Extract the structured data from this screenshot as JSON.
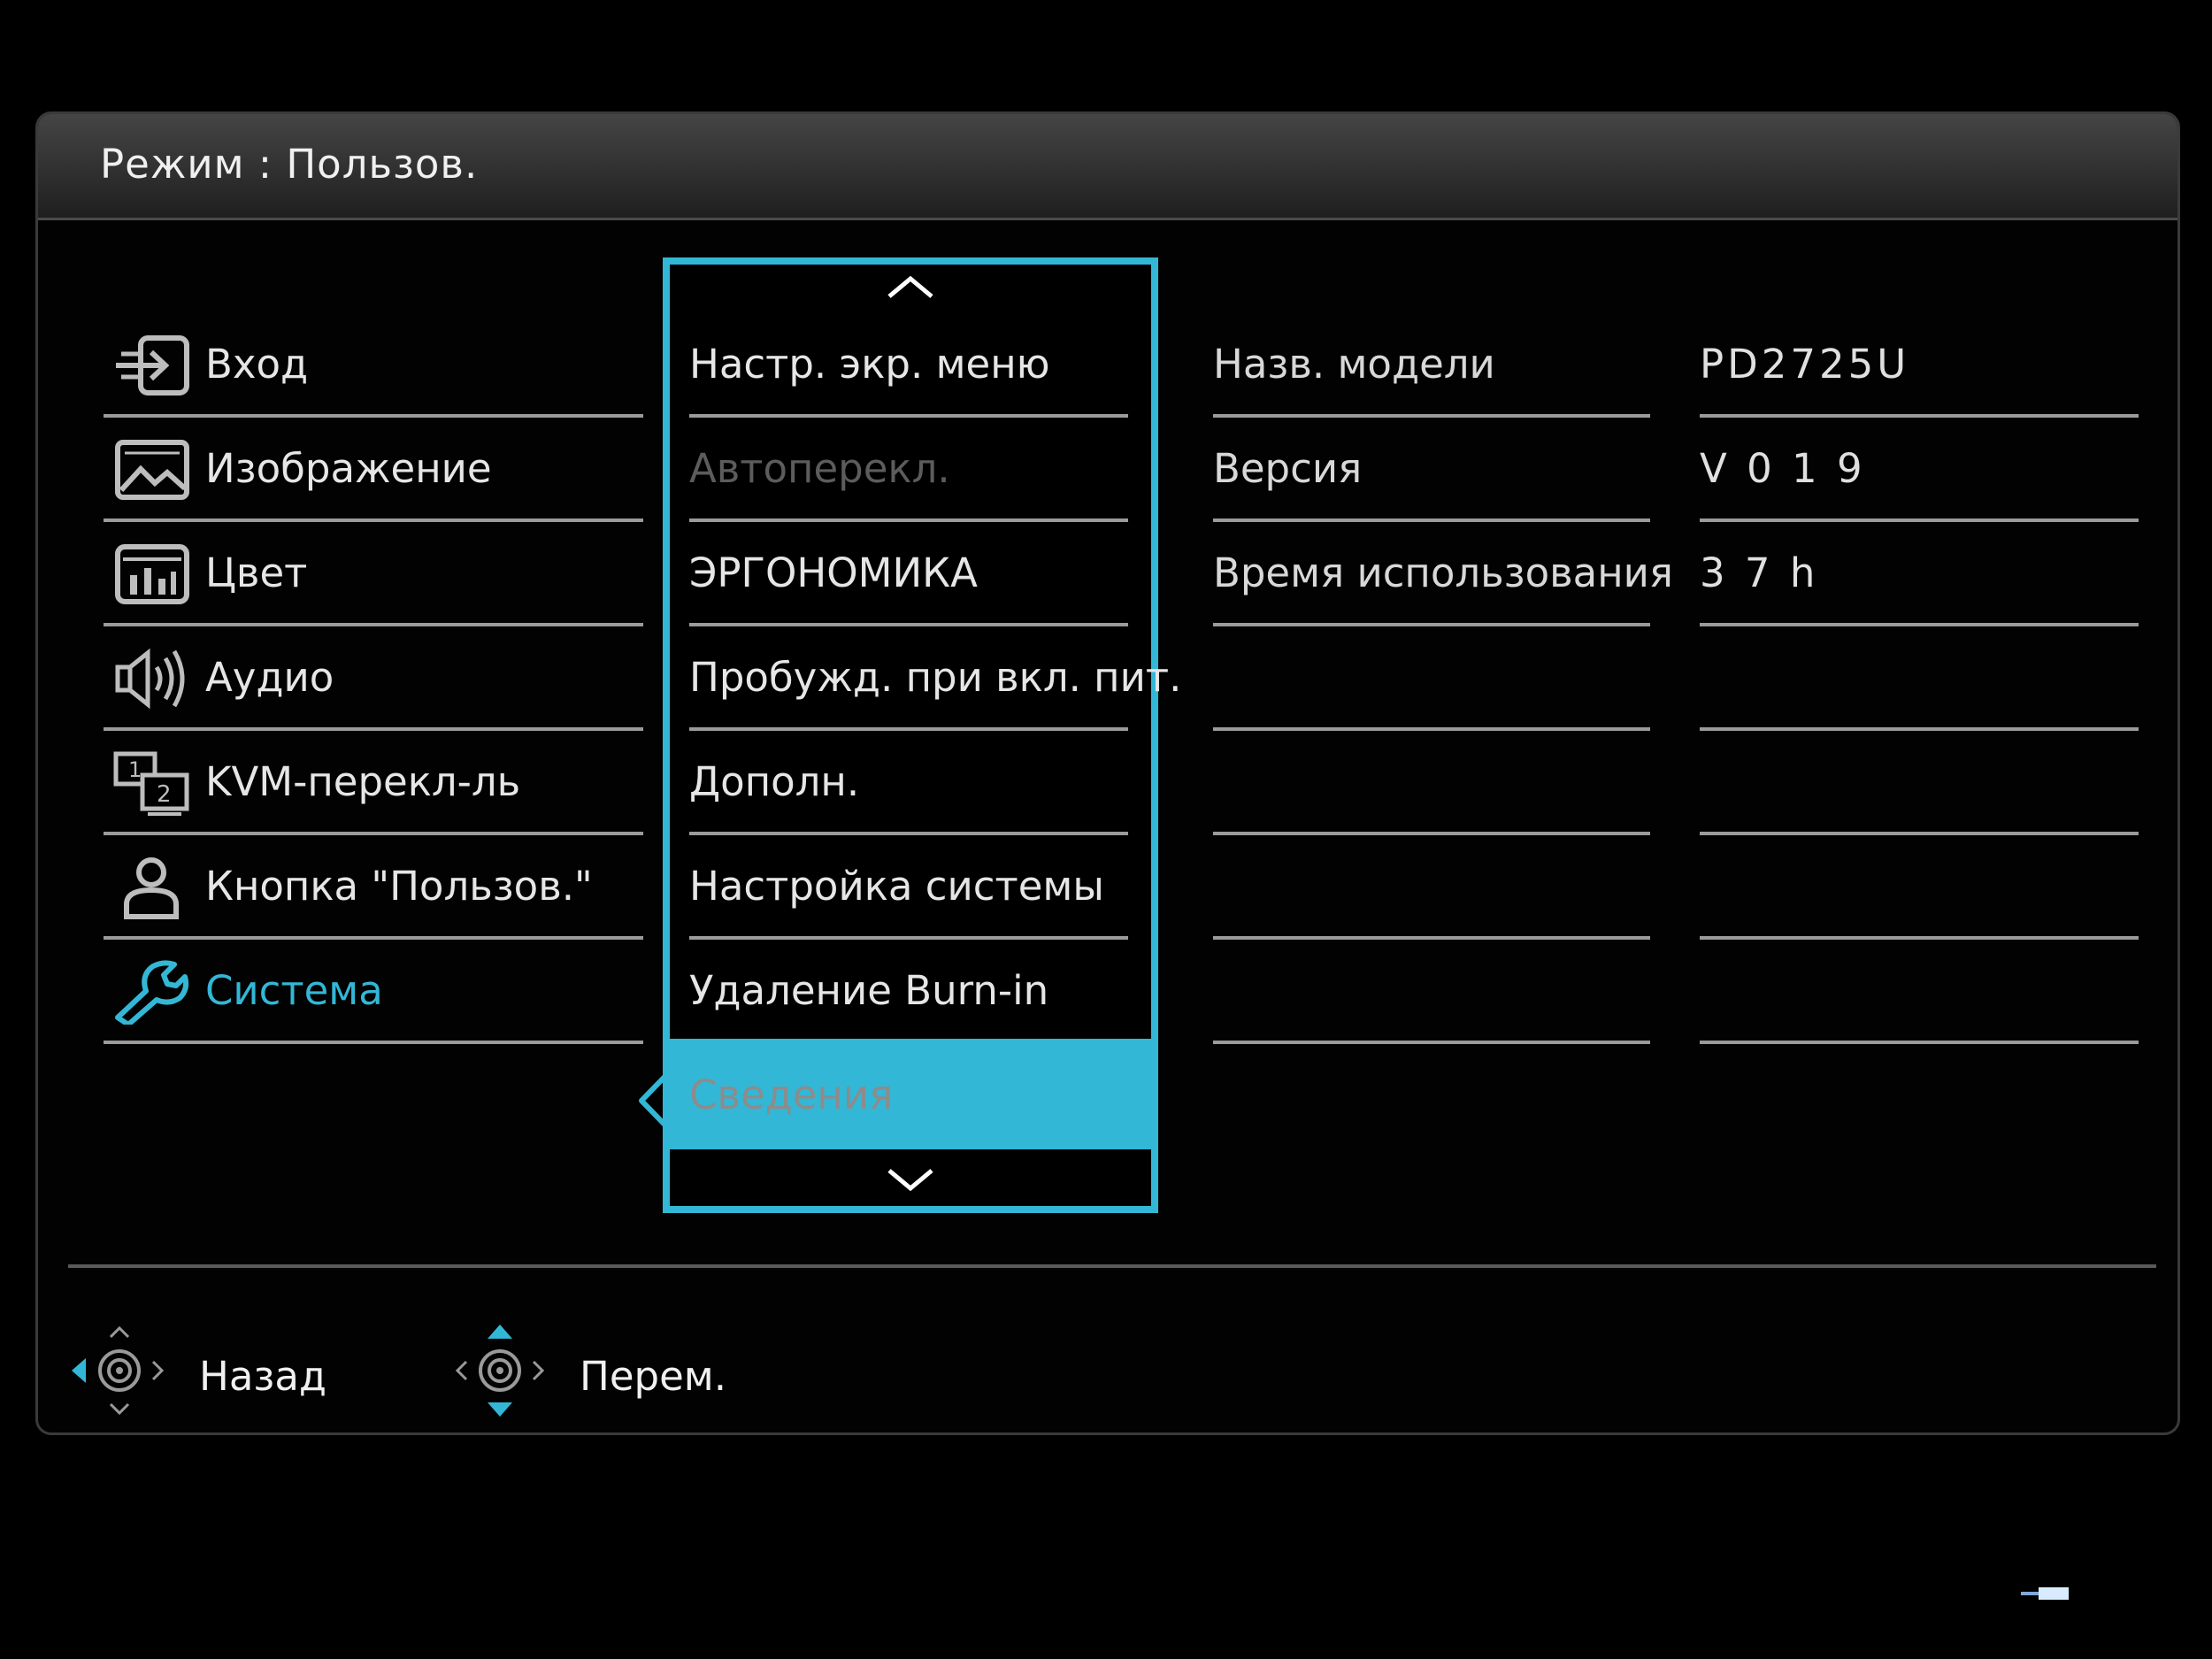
{
  "header": {
    "title": "Режим  : Пользов."
  },
  "left_menu": [
    {
      "label": "Вход",
      "icon": "input-icon",
      "active": false
    },
    {
      "label": "Изображение",
      "icon": "picture-icon",
      "active": false
    },
    {
      "label": "Цвет",
      "icon": "color-icon",
      "active": false
    },
    {
      "label": "Аудио",
      "icon": "speaker-icon",
      "active": false
    },
    {
      "label": "KVM-перекл-ль",
      "icon": "kvm-icon",
      "active": false
    },
    {
      "label": "Кнопка \"Пользов.\"",
      "icon": "user-icon",
      "active": false
    },
    {
      "label": "Система",
      "icon": "wrench-icon",
      "active": true
    }
  ],
  "sub_menu": {
    "items": [
      {
        "label": "Настр. экр. меню",
        "disabled": false
      },
      {
        "label": "Автоперекл.",
        "disabled": true
      },
      {
        "label": "ЭРГОНОМИКА",
        "disabled": false
      },
      {
        "label": "Пробужд. при вкл. пит.",
        "disabled": false
      },
      {
        "label": "Дополн.",
        "disabled": false
      },
      {
        "label": "Настройка системы",
        "disabled": false
      },
      {
        "label": "Удаление Burn-in",
        "disabled": false
      }
    ],
    "selected": "Сведения"
  },
  "info": {
    "rows": [
      {
        "label": "Назв. модели",
        "value": "PD2725U"
      },
      {
        "label": "Версия",
        "value": "V 0 1 9"
      },
      {
        "label": "Время использования",
        "value": "3 7 h"
      }
    ]
  },
  "footer": {
    "back_label": "Назад",
    "move_label": "Перем."
  },
  "colors": {
    "accent": "#33b7d6",
    "background": "#000000",
    "divider": "#9b9b9b"
  }
}
